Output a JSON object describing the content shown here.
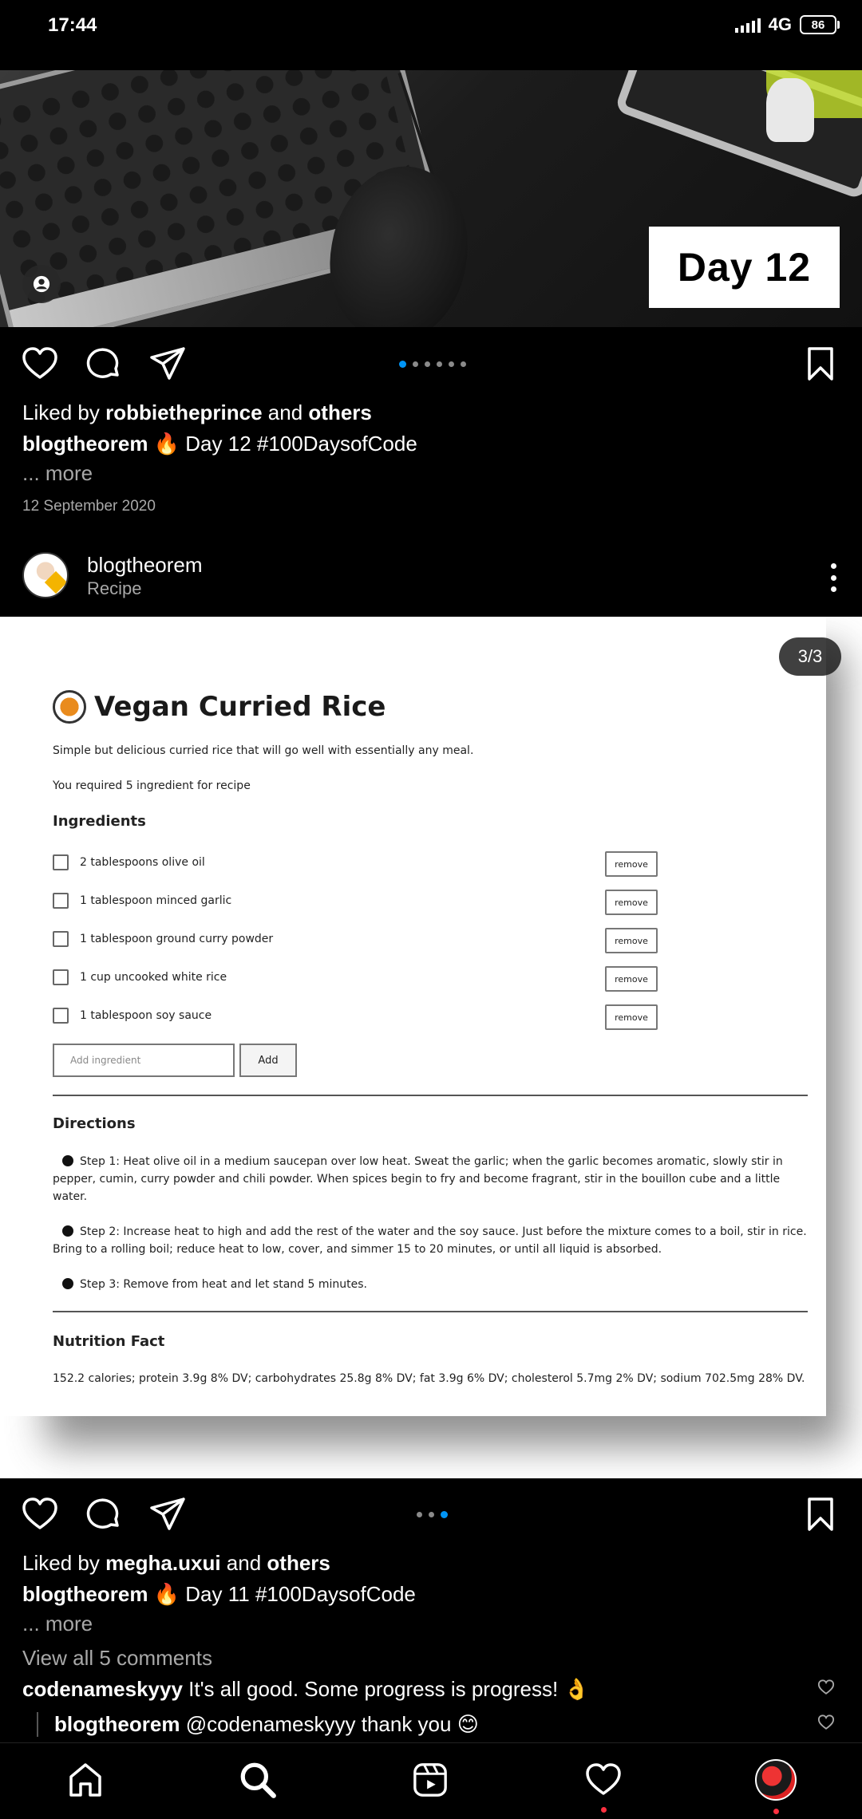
{
  "status_bar": {
    "time": "17:44",
    "network": "4G",
    "battery": "86"
  },
  "post1": {
    "image_badge": "Day 12",
    "liked_by_prefix": "Liked by",
    "liked_by_user": "robbietheprince",
    "liked_by_and": "and",
    "liked_by_others": "others",
    "caption_user": "blogtheorem",
    "caption_text": "🔥 Day 12 #100DaysofCode",
    "more": "... more",
    "date": "12 September 2020"
  },
  "post2": {
    "username": "blogtheorem",
    "subtitle": "Recipe",
    "page_counter": "3/3",
    "recipe": {
      "title": "Vegan Curried Rice",
      "description": "Simple but delicious curried rice that will go well with essentially any meal.",
      "requirement": "You required 5 ingredient for recipe",
      "ingredients_heading": "Ingredients",
      "ingredients": [
        "2 tablespoons olive oil",
        "1 tablespoon minced garlic",
        "1 tablespoon ground curry powder",
        "1 cup uncooked white rice",
        "1 tablespoon soy sauce"
      ],
      "remove_label": "remove",
      "add_placeholder": "Add ingredient",
      "add_label": "Add",
      "directions_heading": "Directions",
      "steps": [
        "Step 1: Heat olive oil in a medium saucepan over low heat. Sweat the garlic; when the garlic becomes aromatic, slowly stir in pepper, cumin, curry powder and chili powder. When spices begin to fry and become fragrant, stir in the bouillon cube and a little water.",
        "Step 2: Increase heat to high and add the rest of the water and the soy sauce. Just before the mixture comes to a boil, stir in rice. Bring to a rolling boil; reduce heat to low, cover, and simmer 15 to 20 minutes, or until all liquid is absorbed.",
        "Step 3: Remove from heat and let stand 5 minutes."
      ],
      "nutrition_heading": "Nutrition Fact",
      "nutrition_text": "152.2 calories; protein 3.9g 8% DV; carbohydrates 25.8g 8% DV; fat 3.9g 6% DV; cholesterol 5.7mg 2% DV; sodium 702.5mg 28% DV."
    },
    "liked_by_prefix": "Liked by",
    "liked_by_user": "megha.uxui",
    "liked_by_and": "and",
    "liked_by_others": "others",
    "caption_user": "blogtheorem",
    "caption_text": "🔥 Day 11 #100DaysofCode",
    "more": "... more",
    "view_comments": "View all 5 comments",
    "comments": [
      {
        "user": "codenameskyyy",
        "text": "It's all good. Some progress is progress! 👌"
      },
      {
        "user": "blogtheorem",
        "text": "@codenameskyyy thank you 😊"
      }
    ]
  },
  "colors": {
    "accent": "#0095f6",
    "notification": "#ff3040",
    "background": "#000000",
    "muted_text": "#a8a8a8"
  },
  "icons": [
    "heart-icon",
    "comment-icon",
    "share-icon",
    "bookmark-icon",
    "more-icon",
    "home-icon",
    "search-icon",
    "reels-icon",
    "activity-icon",
    "profile-icon"
  ]
}
